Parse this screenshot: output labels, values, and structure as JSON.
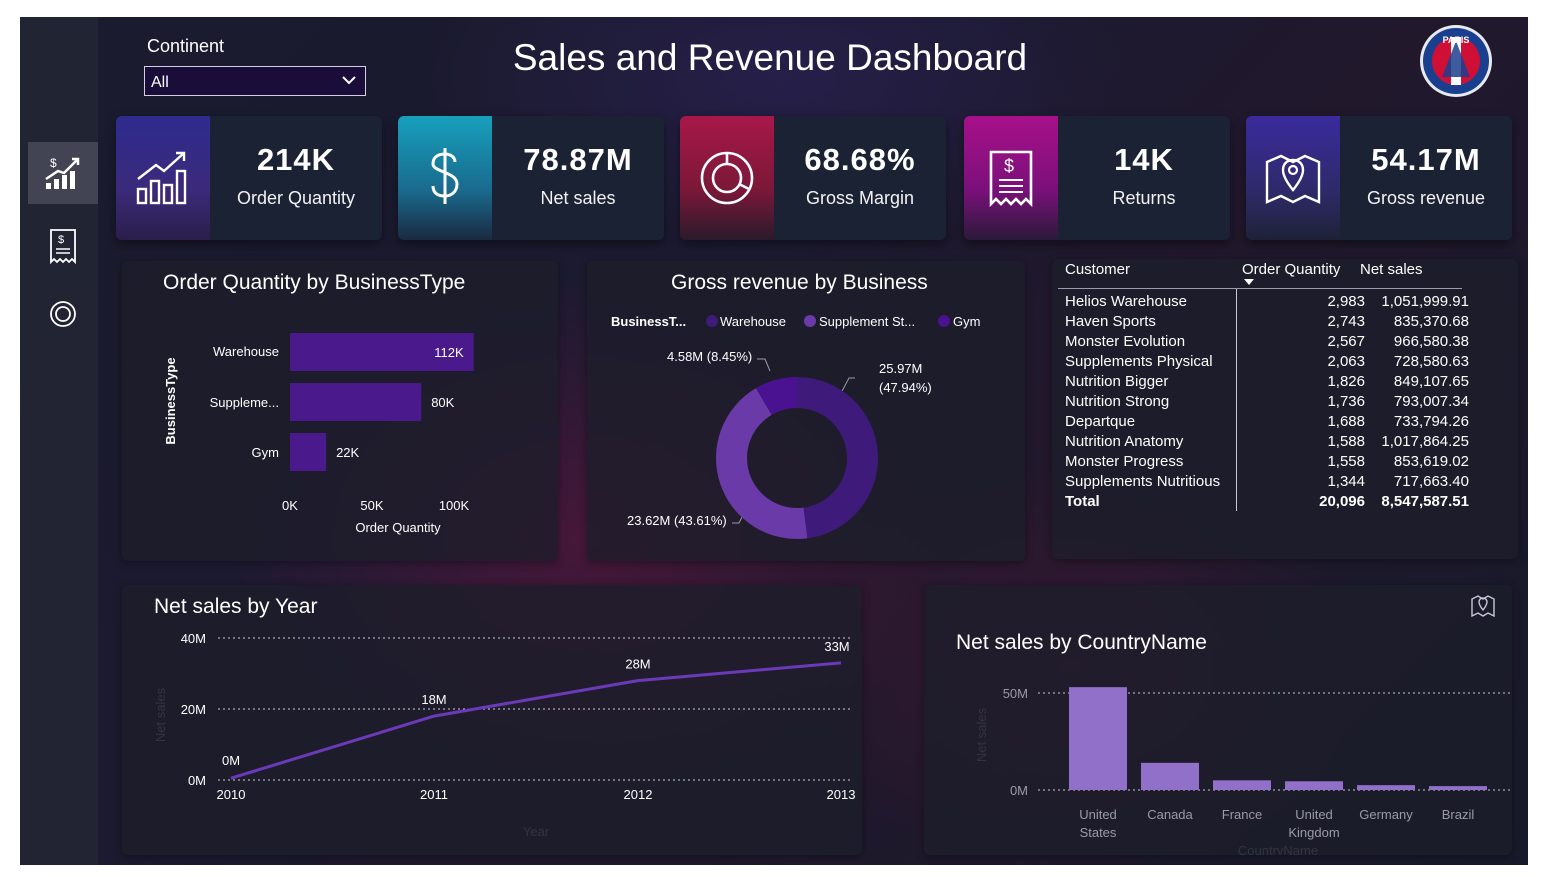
{
  "header": {
    "title": "Sales and Revenue Dashboard",
    "continent_label": "Continent",
    "continent_value": "All"
  },
  "nav": {
    "items": [
      "sales-trend-icon",
      "receipt-icon",
      "target-icon"
    ]
  },
  "kpis": [
    {
      "value": "214K",
      "label": "Order Quantity",
      "icon": "bar-chart-growth-icon",
      "accent": "#3a2a9c"
    },
    {
      "value": "78.87M",
      "label": "Net sales",
      "icon": "dollar-icon",
      "accent": "#1496b4"
    },
    {
      "value": "68.68%",
      "label": "Gross Margin",
      "icon": "donut-icon",
      "accent": "#a01844"
    },
    {
      "value": "14K",
      "label": "Returns",
      "icon": "receipt-icon",
      "accent": "#a0107a"
    },
    {
      "value": "54.17M",
      "label": "Gross revenue",
      "icon": "map-pin-icon",
      "accent": "#3a2a9c"
    }
  ],
  "bar_panel": {
    "title": "Order Quantity by BusinessType",
    "ylabel": "BusinessType",
    "xlabel": "Order Quantity",
    "ticks": [
      "0K",
      "50K",
      "100K"
    ],
    "rows": [
      {
        "label": "Warehouse",
        "value_label": "112K"
      },
      {
        "label": "Suppleme...",
        "value_label": "80K"
      },
      {
        "label": "Gym",
        "value_label": "22K"
      }
    ]
  },
  "donut_panel": {
    "title": "Gross revenue by Business",
    "legend_title": "BusinessT...",
    "legend": [
      "Warehouse",
      "Supplement St...",
      "Gym"
    ],
    "labels": [
      "25.97M",
      "(47.94%)",
      "23.62M (43.61%)",
      "4.58M (8.45%)"
    ]
  },
  "customer_table": {
    "headers": {
      "customer": "Customer",
      "qty": "Order Quantity",
      "sales": "Net sales"
    },
    "rows": [
      {
        "customer": "Helios Warehouse",
        "qty": "2,983",
        "sales": "1,051,999.91"
      },
      {
        "customer": "Haven Sports",
        "qty": "2,743",
        "sales": "835,370.68"
      },
      {
        "customer": "Monster Evolution",
        "qty": "2,567",
        "sales": "966,580.38"
      },
      {
        "customer": "Supplements Physical",
        "qty": "2,063",
        "sales": "728,580.63"
      },
      {
        "customer": "Nutrition Bigger",
        "qty": "1,826",
        "sales": "849,107.65"
      },
      {
        "customer": "Nutrition Strong",
        "qty": "1,736",
        "sales": "793,007.34"
      },
      {
        "customer": "Departque",
        "qty": "1,688",
        "sales": "733,794.26"
      },
      {
        "customer": "Nutrition Anatomy",
        "qty": "1,588",
        "sales": "1,017,864.25"
      },
      {
        "customer": "Monster Progress",
        "qty": "1,558",
        "sales": "853,619.02"
      },
      {
        "customer": "Supplements Nutritious",
        "qty": "1,344",
        "sales": "717,663.40"
      }
    ],
    "total": {
      "customer": "Total",
      "qty": "20,096",
      "sales": "8,547,587.51"
    }
  },
  "line_panel": {
    "title": "Net sales by Year",
    "y_ticks": [
      "40M",
      "20M",
      "0M"
    ],
    "x_ticks": [
      "2010",
      "2011",
      "2012",
      "2013"
    ],
    "ylabel": "Net sales",
    "xlabel": "Year",
    "point_labels": [
      "0M",
      "18M",
      "28M",
      "33M"
    ]
  },
  "country_panel": {
    "title": "Net sales by CountryName",
    "y_ticks": [
      "50M",
      "0M"
    ],
    "ylabel": "Net sales",
    "xlabel": "CountryName",
    "categories": [
      [
        "United",
        "States"
      ],
      [
        "Canada"
      ],
      [
        "France"
      ],
      [
        "United",
        "Kingdom"
      ],
      [
        "Germany"
      ],
      [
        "Brazil"
      ]
    ]
  },
  "chart_data": [
    {
      "type": "bar",
      "orientation": "horizontal",
      "title": "Order Quantity by BusinessType",
      "categories": [
        "Warehouse",
        "Suppleme...",
        "Gym"
      ],
      "values": [
        112000,
        80000,
        22000
      ],
      "xlabel": "Order Quantity",
      "ylabel": "BusinessType",
      "xlim": [
        0,
        100000
      ],
      "color": "#4a1a8c"
    },
    {
      "type": "pie",
      "variant": "donut",
      "title": "Gross revenue by Business",
      "categories": [
        "Warehouse",
        "Supplement St...",
        "Gym"
      ],
      "values": [
        25.97,
        23.62,
        4.58
      ],
      "colors": [
        "#3e1a7a",
        "#6a3aa8",
        "#4a1290"
      ]
    },
    {
      "type": "line",
      "title": "Net sales by Year",
      "x": [
        2010,
        2011,
        2012,
        2013
      ],
      "values": [
        0.5,
        18,
        28,
        33
      ],
      "xlabel": "Year",
      "ylabel": "Net sales",
      "ylim": [
        0,
        40
      ],
      "color": "#6a3ab8"
    },
    {
      "type": "bar",
      "title": "Net sales by CountryName",
      "categories": [
        "United States",
        "Canada",
        "France",
        "United Kingdom",
        "Germany",
        "Brazil"
      ],
      "values": [
        53,
        14,
        5,
        4.5,
        2.5,
        2
      ],
      "xlabel": "CountryName",
      "ylabel": "Net sales",
      "ylim": [
        0,
        50
      ],
      "color": "#9070c8"
    }
  ]
}
